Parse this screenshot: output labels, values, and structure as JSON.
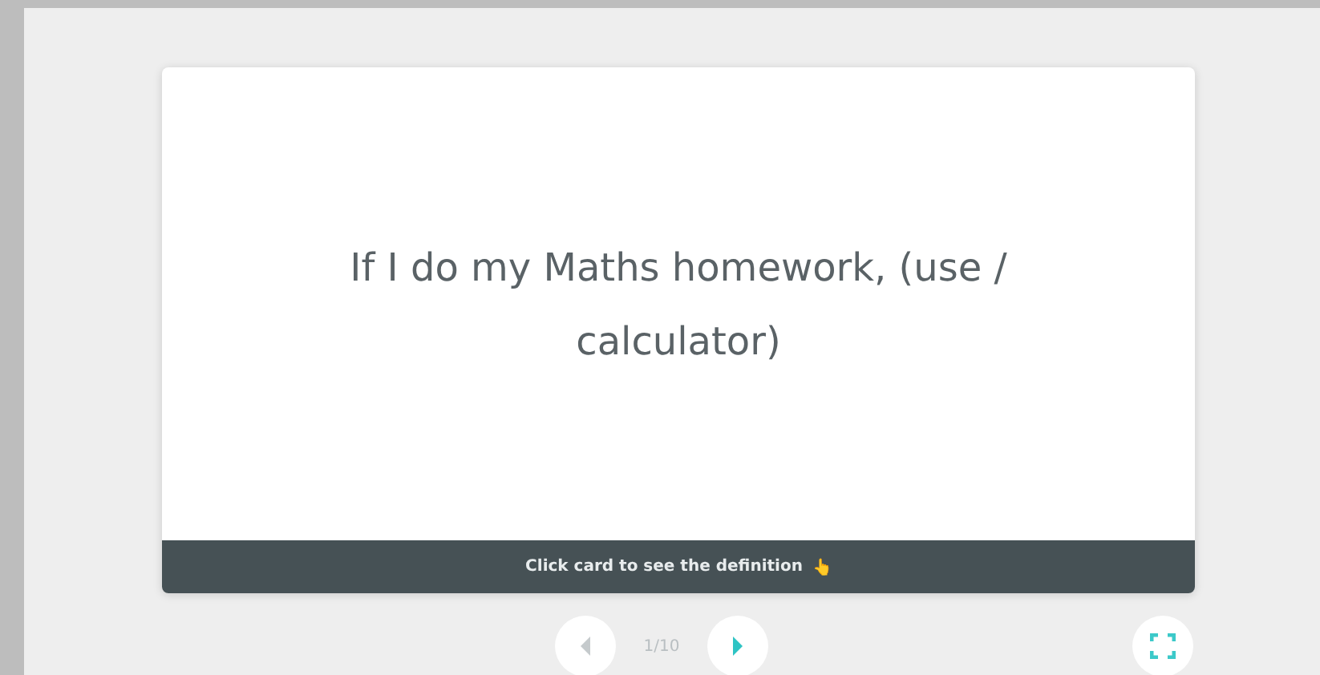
{
  "card": {
    "term": "If I do my Maths homework, (use / calculator)",
    "hint": "Click card to see the definition",
    "hint_icon": "👆"
  },
  "controls": {
    "prev": {
      "disabled": true
    },
    "counter": "1/10",
    "next": {
      "disabled": false
    }
  }
}
